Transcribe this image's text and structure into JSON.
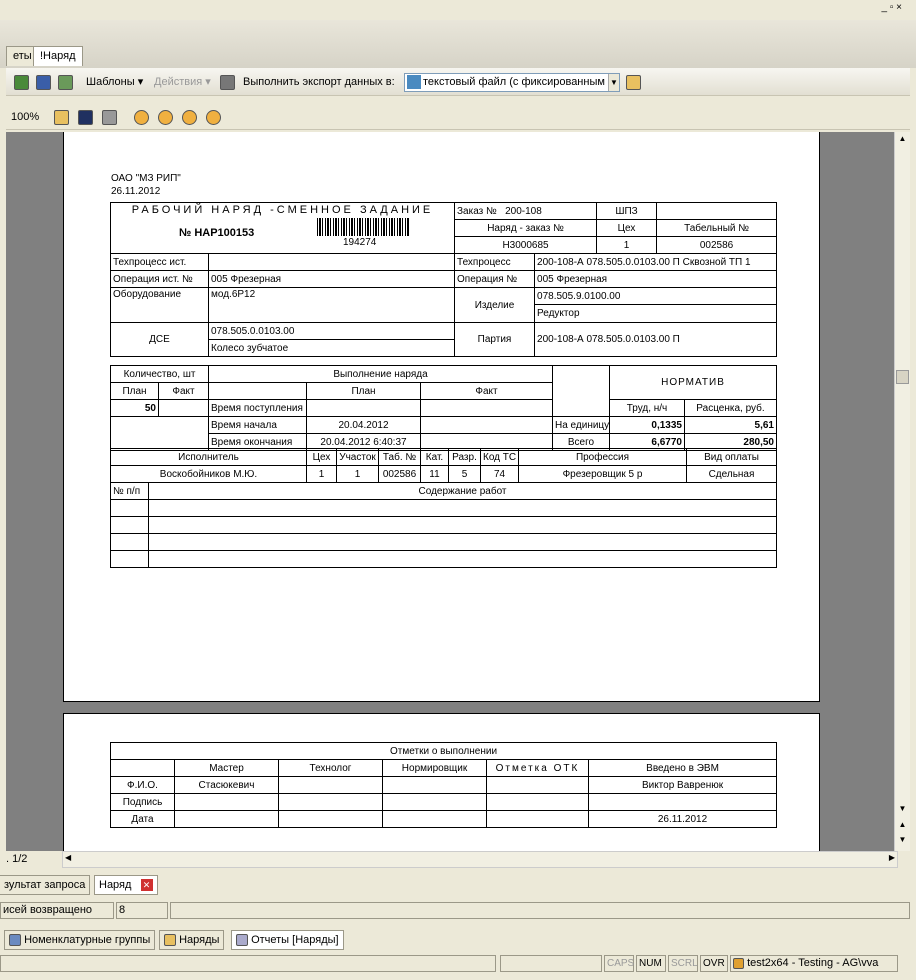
{
  "tabs": {
    "t1": "еты",
    "t2": "!Наряд"
  },
  "toolbar": {
    "templates": "Шаблоны",
    "actions": "Действия",
    "export_label": "Выполнить экспорт данных в:",
    "export_value": "текстовый файл (с фиксированным",
    "zoom": "100%"
  },
  "doc": {
    "org": "ОАО \"МЗ РИП\"",
    "date": "26.11.2012",
    "title": "РАБОЧИЙ НАРЯД -СМЕННОЕ ЗАДАНИЕ",
    "number": "№ НАР100153",
    "barcode": "194274",
    "order_label": "Заказ №",
    "order_value": "200-108",
    "shpz": "ШПЗ",
    "naryad_order_label": "Наряд - заказ №",
    "ceh_label": "Цех",
    "tab_label": "Табельный №",
    "naryad_order_value": "Н3000685",
    "ceh_value": "1",
    "tab_value": "002586",
    "tp_src_label": "Техпроцесс ист.",
    "tp_label": "Техпроцесс",
    "tp_value": "200-108-А 078.505.0.0103.00 П Сквозной ТП 1",
    "op_src_label": "Операция ист. №",
    "op_src_value": "005 Фрезерная",
    "op_label": "Операция №",
    "op_value": "005 Фрезерная",
    "equip_label": "Оборудование",
    "equip_value": "мод.6Р12",
    "izd_label": "Изделие",
    "izd_value1": "078.505.9.0100.00",
    "izd_value2": "Редуктор",
    "dse_label": "ДСЕ",
    "dse_value1": "078.505.0.0103.00",
    "dse_value2": "Колесо зубчатое",
    "party_label": "Партия",
    "party_value": "200-108-А 078.505.0.0103.00 П",
    "qty_label": "Количество, шт",
    "exec_label": "Выполнение наряда",
    "norm_label": "НОРМАТИВ",
    "plan": "План",
    "fact": "Факт",
    "plan_qty": "50",
    "t_recv": "Время поступления",
    "t_start": "Время начала",
    "t_end": "Время окончания",
    "t_start_plan": "20.04.2012",
    "t_end_plan": "20.04.2012 6:40:37",
    "labor_label": "Труд, н/ч",
    "price_label": "Расценка, руб.",
    "per_unit": "На единицу",
    "per_unit_labor": "0,1335",
    "per_unit_price": "5,61",
    "total": "Всего",
    "total_labor": "6,6770",
    "total_price": "280,50",
    "h_exec": "Исполнитель",
    "h_ceh": "Цех",
    "h_uch": "Участок",
    "h_tab": "Таб. №",
    "h_kat": "Кат.",
    "h_razr": "Разр.",
    "h_kod": "Код ТС",
    "h_prof": "Профессия",
    "h_pay": "Вид оплаты",
    "r_exec": "Воскобойников М.Ю.",
    "r_ceh": "1",
    "r_uch": "1",
    "r_tab": "002586",
    "r_kat": "11",
    "r_razr": "5",
    "r_kod": "74",
    "r_prof": "Фрезеровщик 5 р",
    "r_pay": "Сдельная",
    "np_label": "№ п/п",
    "content_label": "Содержание работ"
  },
  "page2": {
    "title": "Отметки о выполнении",
    "master": "Мастер",
    "tech": "Технолог",
    "norm": "Нормировщик",
    "otk": "Отметка ОТК",
    "evm": "Введено в ЭВМ",
    "fio": "Ф.И.О.",
    "fio_master": "Стасюкевич",
    "fio_evm": "Виктор Вавренюк",
    "sign": "Подпись",
    "date_label": "Дата",
    "date_evm": "26.11.2012"
  },
  "nav": {
    "page": ". 1/2"
  },
  "bottom_tabs": {
    "b1": "зультат запроса",
    "b2": "Наряд"
  },
  "status": {
    "records": "исей возвращено",
    "count": "8"
  },
  "taskbar": {
    "t1": "Номенклатурные группы",
    "t2": "Наряды",
    "t3": "Отчеты  [Наряды]"
  },
  "statusbar": {
    "caps": "CAPS",
    "num": "NUM",
    "scrl": "SCRL",
    "ovr": "OVR",
    "user": "test2x64 - Testing - AG\\vva"
  }
}
